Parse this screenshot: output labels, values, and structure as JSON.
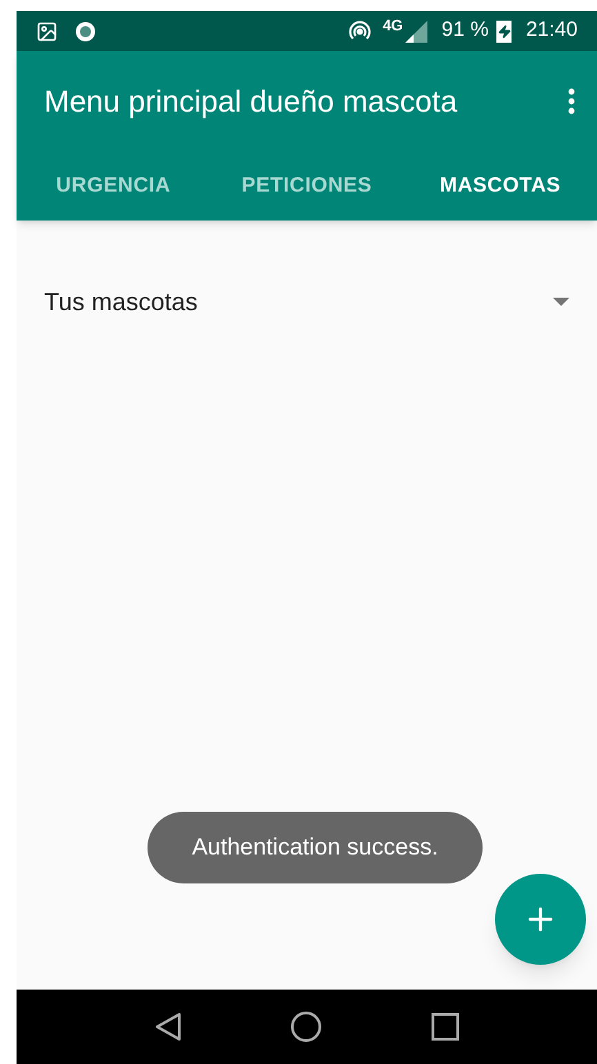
{
  "status_bar": {
    "network": "4G",
    "battery": "91 %",
    "time": "21:40"
  },
  "app_bar": {
    "title": "Menu principal dueño mascota"
  },
  "tabs": [
    {
      "label": "URGENCIA",
      "selected": false
    },
    {
      "label": "PETICIONES",
      "selected": false
    },
    {
      "label": "MASCOTAS",
      "selected": true
    }
  ],
  "dropdown": {
    "value": "Tus mascotas"
  },
  "toast": "Authentication success."
}
